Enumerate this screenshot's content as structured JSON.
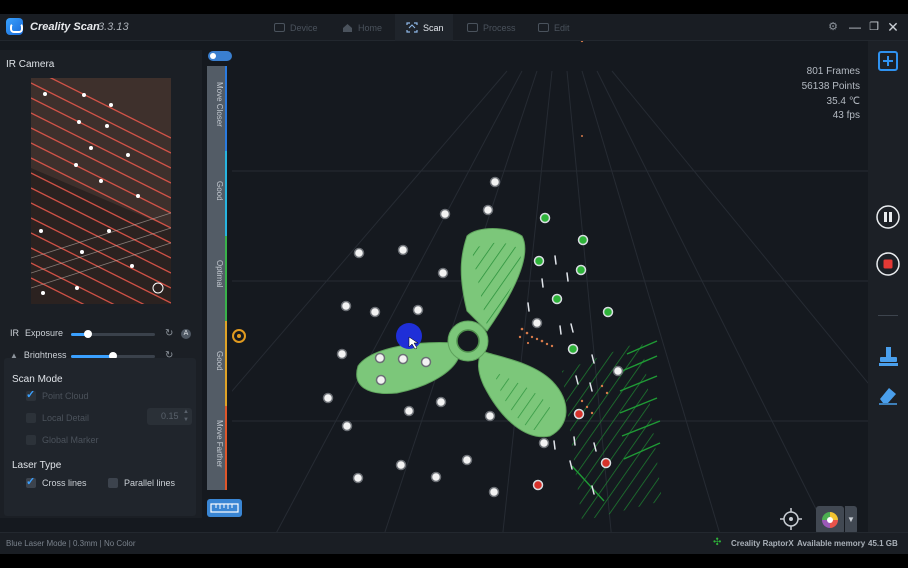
{
  "app": {
    "name": "Creality Scan",
    "version": "3.3.13"
  },
  "tabs": [
    {
      "label": "Device",
      "icon": "device-icon",
      "active": false
    },
    {
      "label": "Home",
      "icon": "home-icon",
      "active": false
    },
    {
      "label": "Scan",
      "icon": "scan-icon",
      "active": true
    },
    {
      "label": "Process",
      "icon": "process-icon",
      "active": false
    },
    {
      "label": "Edit",
      "icon": "edit-icon",
      "active": false
    }
  ],
  "left_panel": {
    "ir_camera_title": "IR Camera",
    "ir_prefix": "IR",
    "exposure_label": "Exposure",
    "exposure_level": 0.2,
    "auto_badge": "A",
    "brightness_label": "Brightness",
    "brightness_level": 0.5,
    "scan_mode_title": "Scan Mode",
    "scan_mode_options": [
      {
        "label": "Point Cloud",
        "checked": true,
        "enabled": false
      },
      {
        "label": "Local Detail",
        "checked": false,
        "enabled": false
      },
      {
        "label": "Global Marker",
        "checked": false,
        "enabled": false
      }
    ],
    "local_detail_value": "0.15",
    "laser_type_title": "Laser Type",
    "laser_options": [
      {
        "label": "Cross lines",
        "checked": true
      },
      {
        "label": "Parallel lines",
        "checked": false
      }
    ]
  },
  "distance_bar": {
    "segments": [
      {
        "label": "Move Closer",
        "color": "#2a7be0"
      },
      {
        "label": "Good",
        "color": "#27b5e0"
      },
      {
        "label": "Optimal",
        "color": "#38b24a"
      },
      {
        "label": "Good",
        "color": "#e0a326"
      },
      {
        "label": "Move Farther",
        "color": "#e0562a"
      }
    ]
  },
  "stats": {
    "frames": "801 Frames",
    "points": "56138 Points",
    "temperature": "35.4 ℃",
    "fps": "43 fps"
  },
  "status_bar": {
    "mode": "Blue Laser Mode | 0.3mm | No Color",
    "device": "Creality RaptorX",
    "memory_label": "Available memory",
    "memory_value": "45.1 GB"
  },
  "colors": {
    "accent": "#3aa0ff",
    "model_green": "#7cc77a",
    "stop_red": "#e53935",
    "marker_green": "#2fb33a",
    "marker_red": "#d7322a"
  }
}
